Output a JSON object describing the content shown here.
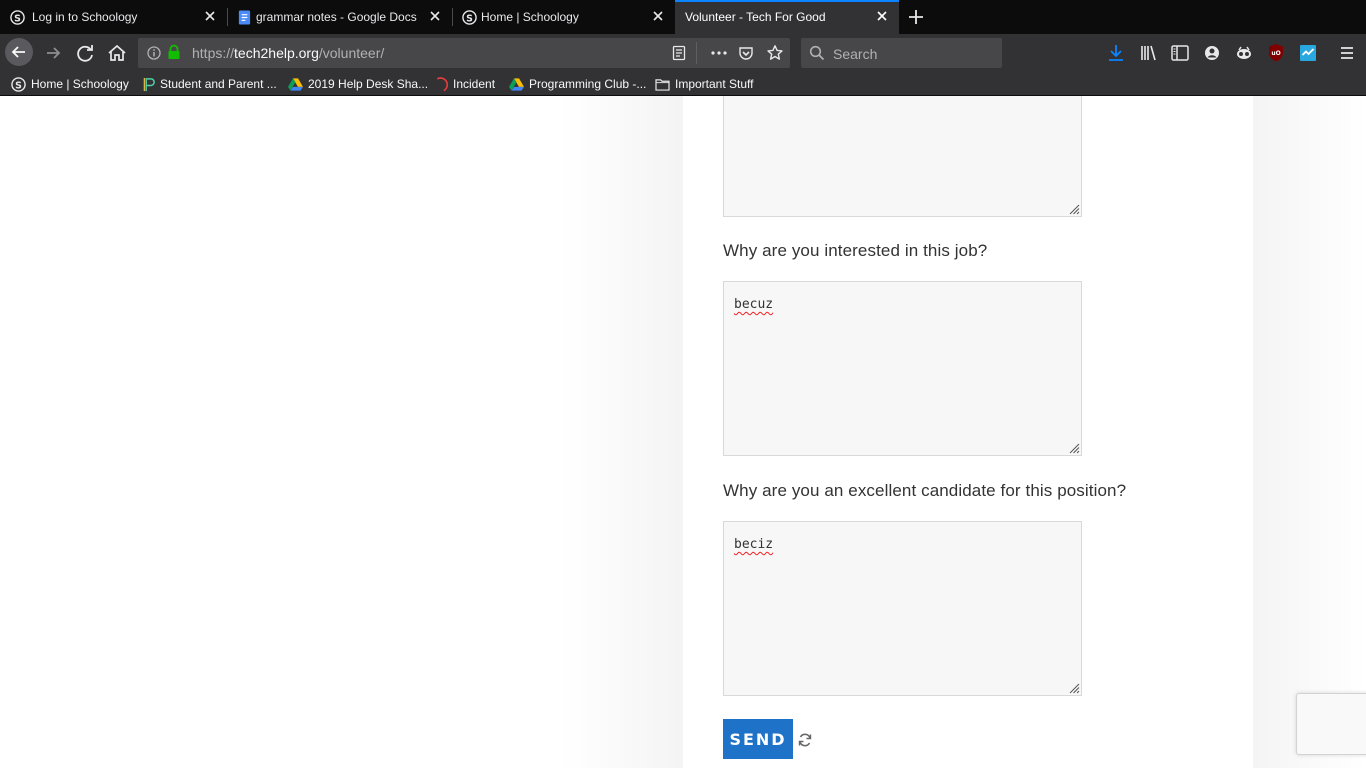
{
  "browser": {
    "tabs": [
      {
        "label": "Log in to Schoology",
        "icon": "schoology-icon",
        "active": false
      },
      {
        "label": "grammar notes - Google Docs",
        "icon": "google-docs-icon",
        "active": false
      },
      {
        "label": "Home | Schoology",
        "icon": "schoology-icon",
        "active": false
      },
      {
        "label": "Volunteer - Tech For Good",
        "icon": "",
        "active": true
      }
    ],
    "url": {
      "scheme": "https://",
      "domain": "tech2help.org",
      "path": "/volunteer/"
    },
    "search_placeholder": "Search",
    "bookmarks": [
      {
        "label": "Home | Schoology",
        "icon": "schoology-icon"
      },
      {
        "label": "Student and Parent ...",
        "icon": "p-logo-icon"
      },
      {
        "label": "2019 Help Desk Sha...",
        "icon": "google-drive-icon"
      },
      {
        "label": "Incident",
        "icon": "incident-icon"
      },
      {
        "label": "Programming Club -...",
        "icon": "google-drive-icon"
      },
      {
        "label": "Important Stuff",
        "icon": "folder-icon"
      }
    ],
    "accent_color": "#0a84ff"
  },
  "form": {
    "questions": [
      {
        "label": "",
        "value": ""
      },
      {
        "label": "Why are you interested in this job?",
        "value": "becuz"
      },
      {
        "label": "Why are you an excellent candidate for this position?",
        "value": "beciz"
      }
    ],
    "submit_label": "SEND",
    "submit_color": "#1e73c8"
  }
}
